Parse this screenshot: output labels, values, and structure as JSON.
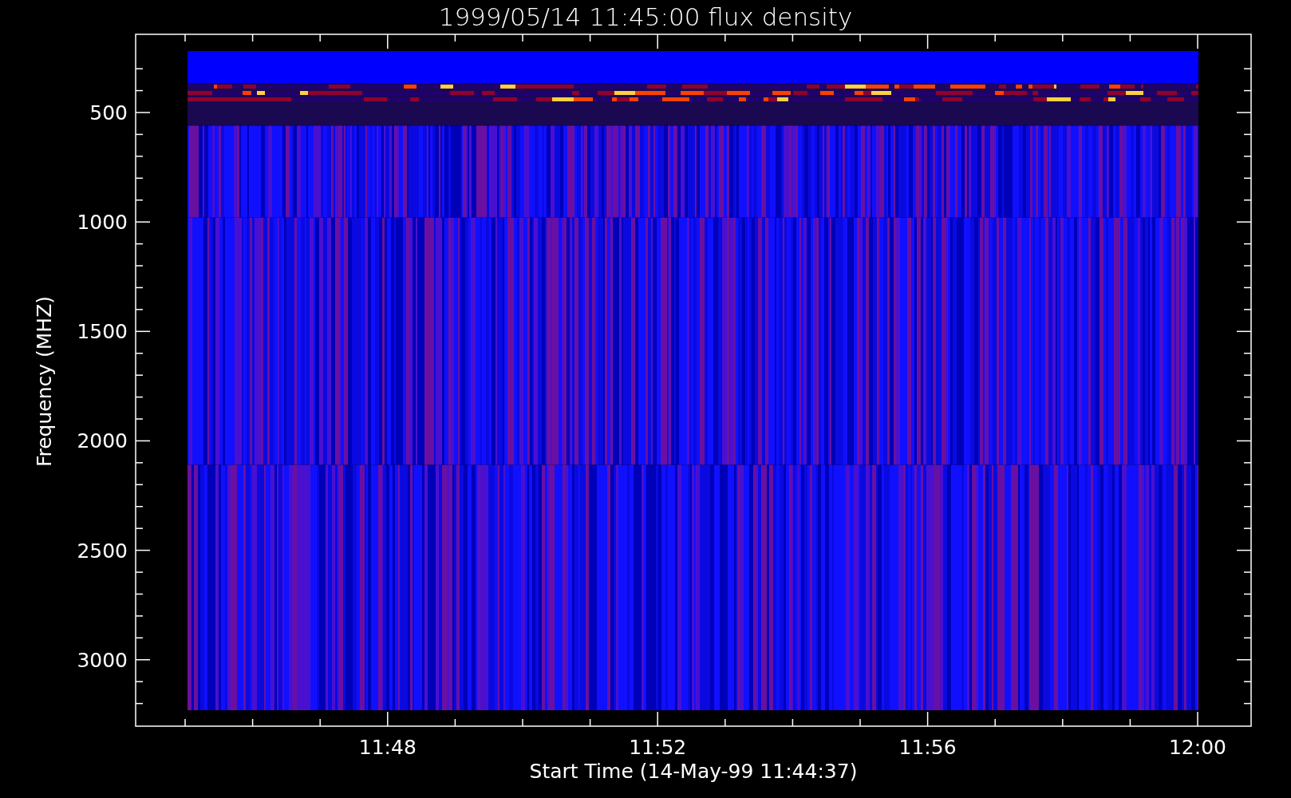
{
  "plot": {
    "title": "1999/05/14 11:45:00 flux density",
    "y_axis_label": "Frequency (MHZ)",
    "x_axis_label": "Start Time (14-May-99 11:44:37)",
    "y_tick_labels": [
      "500",
      "1000",
      "1500",
      "2000",
      "2500",
      "3000"
    ],
    "x_tick_labels": [
      "11:48",
      "11:52",
      "11:56",
      "12:00"
    ]
  }
}
